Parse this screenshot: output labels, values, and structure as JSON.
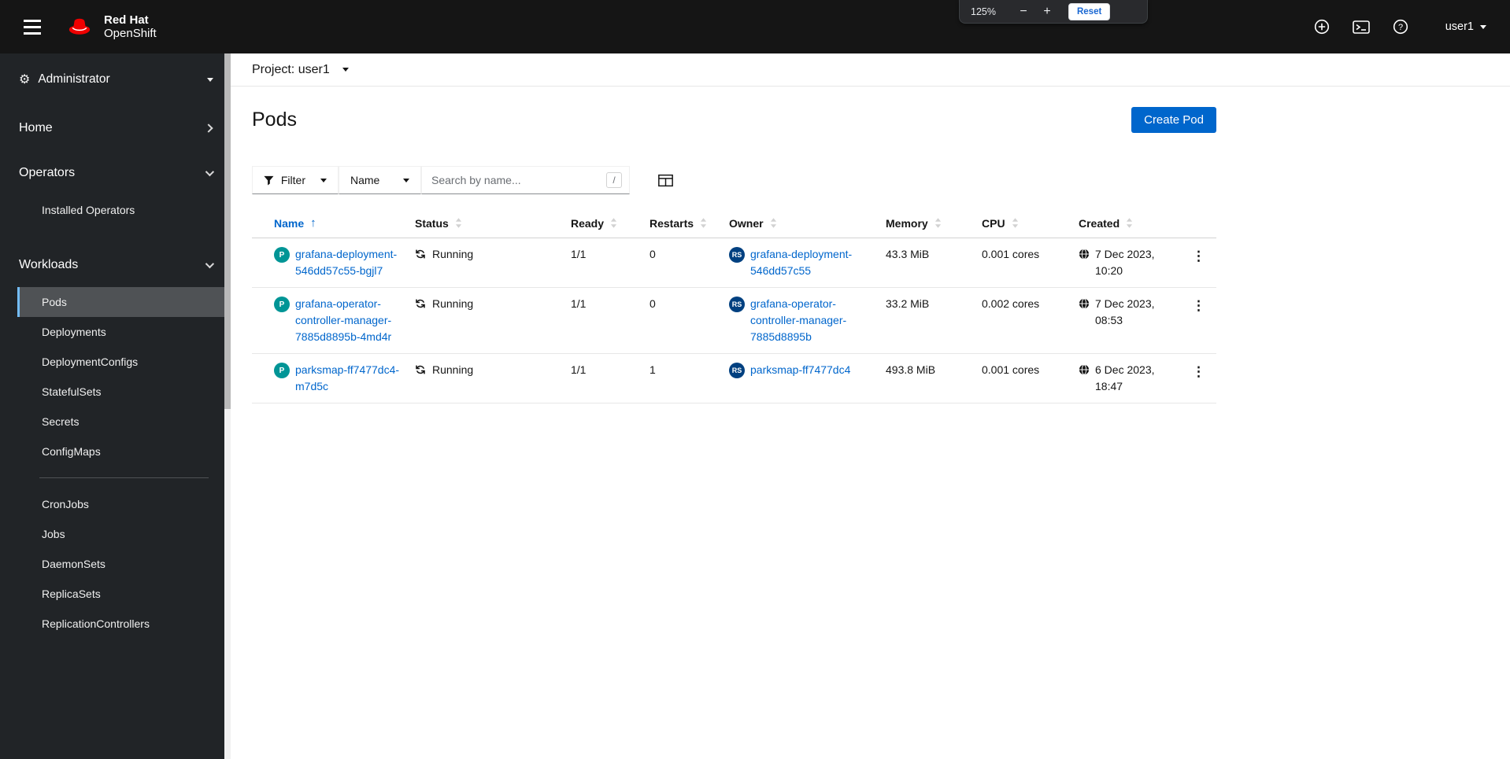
{
  "masthead": {
    "brand_line1": "Red Hat",
    "brand_line2": "OpenShift",
    "username": "user1"
  },
  "zoom_popup": {
    "level": "125%",
    "minus": "−",
    "plus": "+",
    "reset": "Reset"
  },
  "sidebar": {
    "perspective": "Administrator",
    "home": "Home",
    "operators": "Operators",
    "operators_items": [
      "Installed Operators"
    ],
    "workloads": "Workloads",
    "workloads_items": [
      "Pods",
      "Deployments",
      "DeploymentConfigs",
      "StatefulSets",
      "Secrets",
      "ConfigMaps",
      "CronJobs",
      "Jobs",
      "DaemonSets",
      "ReplicaSets",
      "ReplicationControllers"
    ],
    "active_item": "Pods"
  },
  "project_bar": {
    "label": "Project: user1"
  },
  "page": {
    "title": "Pods",
    "create_button": "Create Pod"
  },
  "toolbar": {
    "filter": "Filter",
    "name_filter": "Name",
    "search_placeholder": "Search by name...",
    "search_shortcut": "/"
  },
  "table": {
    "columns": [
      "Name",
      "Status",
      "Ready",
      "Restarts",
      "Owner",
      "Memory",
      "CPU",
      "Created"
    ],
    "pod_badge": "P",
    "rs_badge": "RS",
    "rows": [
      {
        "name": "grafana-deployment-546dd57c55-bgjl7",
        "status": "Running",
        "ready": "1/1",
        "restarts": "0",
        "owner": "grafana-deployment-546dd57c55",
        "memory": "43.3 MiB",
        "cpu": "0.001 cores",
        "created": "7 Dec 2023, 10:20"
      },
      {
        "name": "grafana-operator-controller-manager-7885d8895b-4md4r",
        "status": "Running",
        "ready": "1/1",
        "restarts": "0",
        "owner": "grafana-operator-controller-manager-7885d8895b",
        "memory": "33.2 MiB",
        "cpu": "0.002 cores",
        "created": "7 Dec 2023, 08:53"
      },
      {
        "name": "parksmap-ff7477dc4-m7d5c",
        "status": "Running",
        "ready": "1/1",
        "restarts": "1",
        "owner": "parksmap-ff7477dc4",
        "memory": "493.8 MiB",
        "cpu": "0.001 cores",
        "created": "6 Dec 2023, 18:47"
      }
    ]
  },
  "colors": {
    "accent": "#0066cc",
    "masthead": "#151515",
    "sidebar": "#212427",
    "pod_badge": "#009596",
    "rs_badge": "#004080",
    "active_nav": "#4f5255",
    "active_nav_border": "#73bcf7"
  }
}
